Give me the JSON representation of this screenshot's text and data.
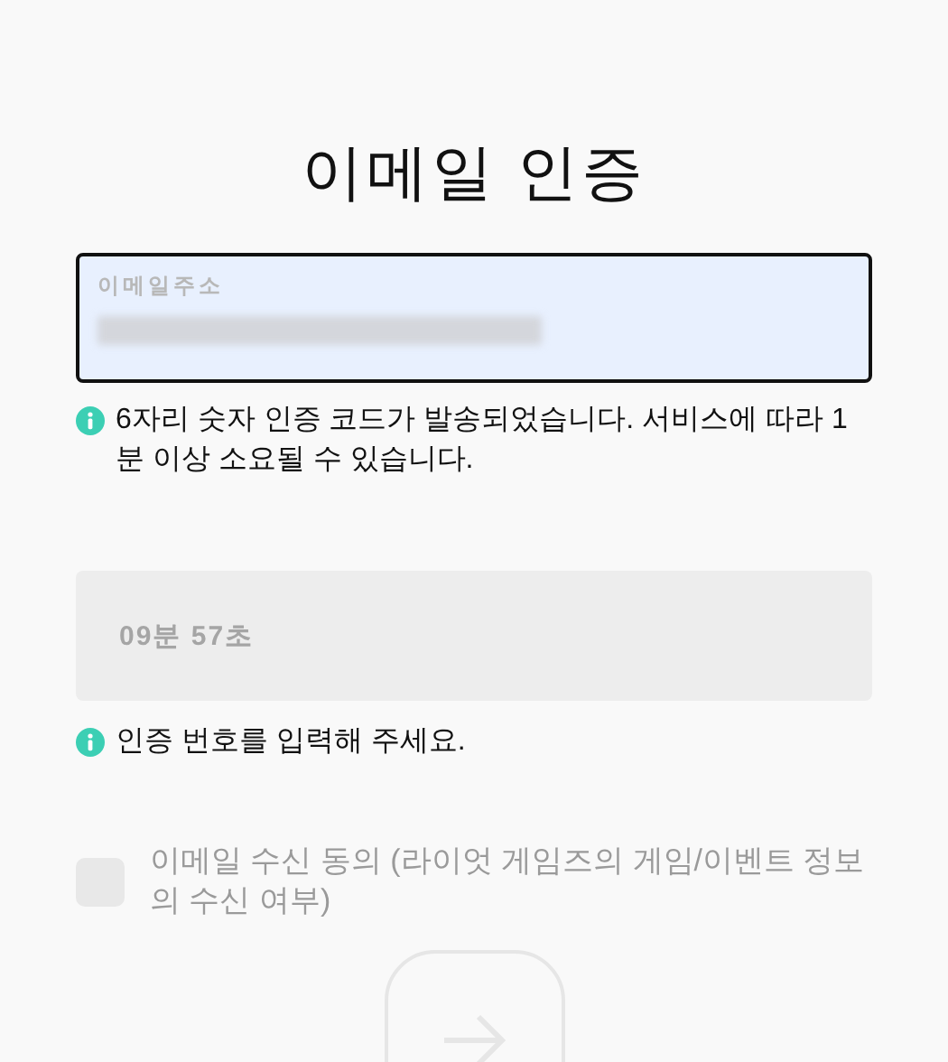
{
  "title": "이메일 인증",
  "email_field": {
    "label": "이메일주소",
    "value_redacted": true
  },
  "email_hint": "6자리 숫자 인증 코드가 발송되었습니다. 서비스에 따라 1분 이상 소요될 수 있습니다.",
  "code_field": {
    "placeholder": "09분 57초"
  },
  "code_hint": "인증 번호를 입력해 주세요.",
  "consent": {
    "label": "이메일 수신 동의 (라이엇 게임즈의 게임/이벤트 정보의 수신 여부)",
    "checked": false
  },
  "next_button": {
    "disabled": true
  }
}
